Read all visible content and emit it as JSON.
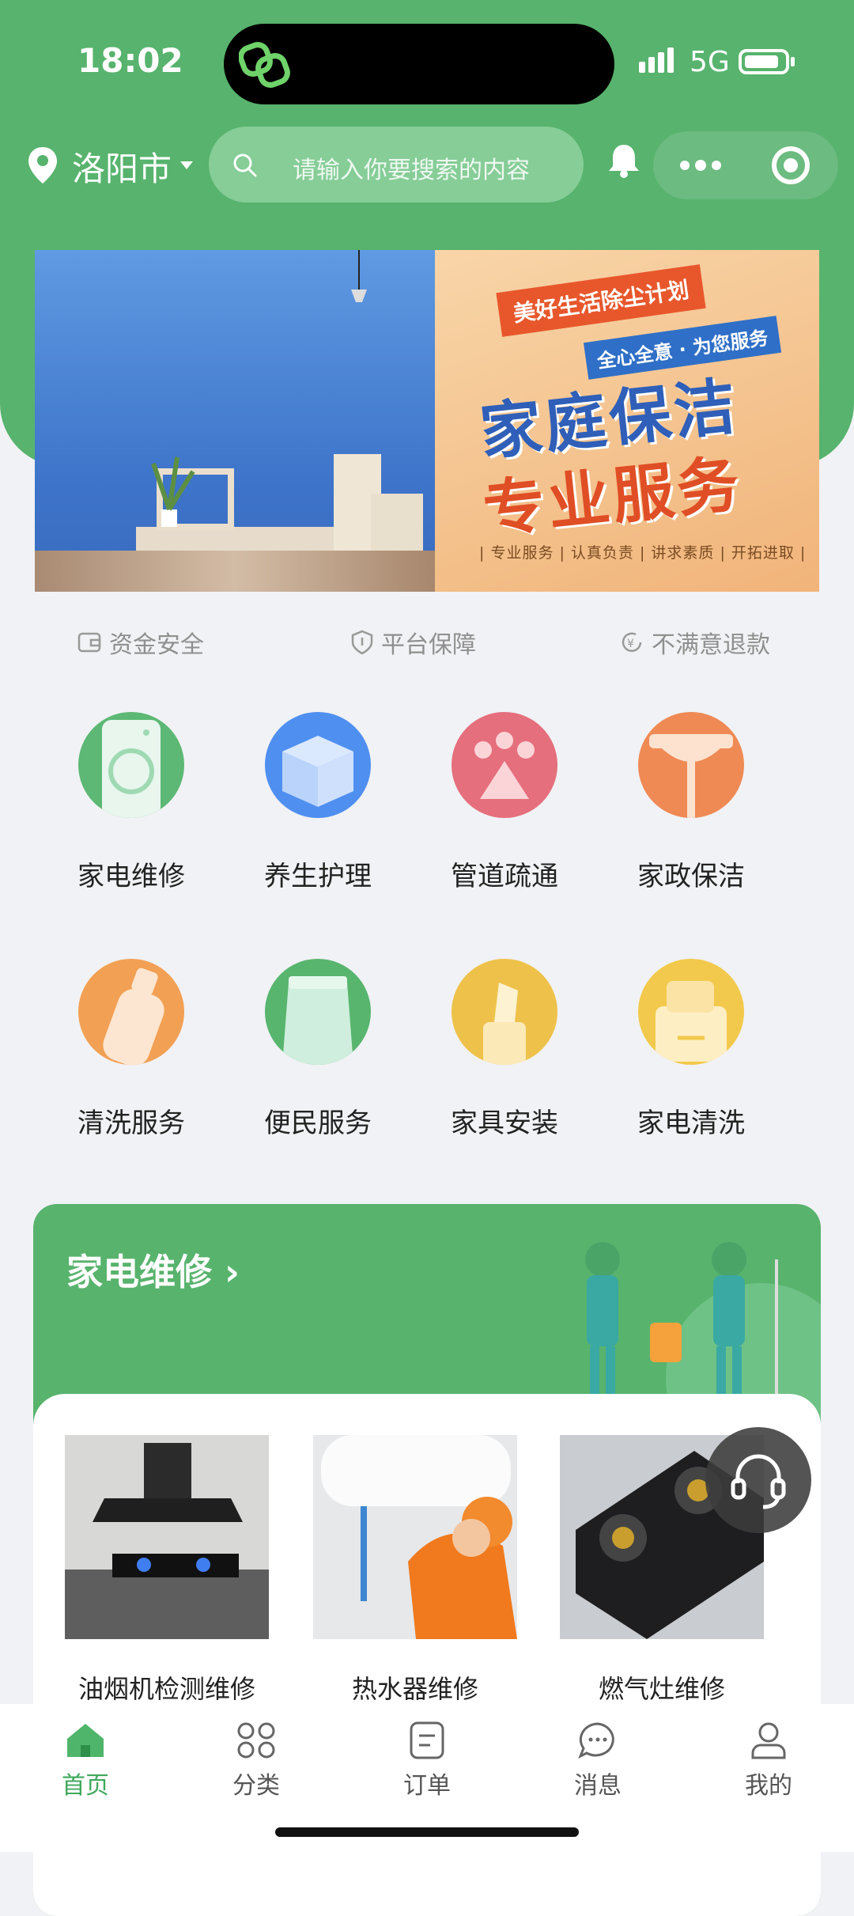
{
  "status_bar": {
    "time": "18:02",
    "network": "5G"
  },
  "header": {
    "city": "洛阳市",
    "search_placeholder": "请输入你要搜索的内容"
  },
  "guarantees": [
    "资金安全",
    "平台保障",
    "不满意退款"
  ],
  "banner": {
    "tag": "美好生活除尘计划",
    "sub": "全心全意 · 为您服务",
    "headline_1": "家庭保洁",
    "headline_2": "专业服务",
    "footer": "| 专业服务 | 认真负责 | 讲求素质 | 开拓进取 |"
  },
  "categories": [
    {
      "label": "家电维修",
      "color": "#5cb874"
    },
    {
      "label": "养生护理",
      "color": "#4f8ff0"
    },
    {
      "label": "管道疏通",
      "color": "#e56f7c"
    },
    {
      "label": "家政保洁",
      "color": "#ef8a55"
    },
    {
      "label": "清洗服务",
      "color": "#f2a054"
    },
    {
      "label": "便民服务",
      "color": "#58b56e"
    },
    {
      "label": "家具安装",
      "color": "#eec24a"
    },
    {
      "label": "家电清洗",
      "color": "#f2c94c"
    }
  ],
  "section": {
    "title": "家电维修 ›",
    "products": [
      {
        "name": "油烟机检测维修"
      },
      {
        "name": "热水器维修"
      },
      {
        "name": "燃气灶维修"
      }
    ]
  },
  "tabbar": [
    {
      "label": "首页",
      "icon": "home-icon",
      "active": true
    },
    {
      "label": "分类",
      "icon": "grid-icon",
      "active": false
    },
    {
      "label": "订单",
      "icon": "order-icon",
      "active": false
    },
    {
      "label": "消息",
      "icon": "message-icon",
      "active": false
    },
    {
      "label": "我的",
      "icon": "profile-icon",
      "active": false
    }
  ],
  "colors": {
    "brand_green": "#57b36d",
    "active_tab": "#3fa85c"
  }
}
